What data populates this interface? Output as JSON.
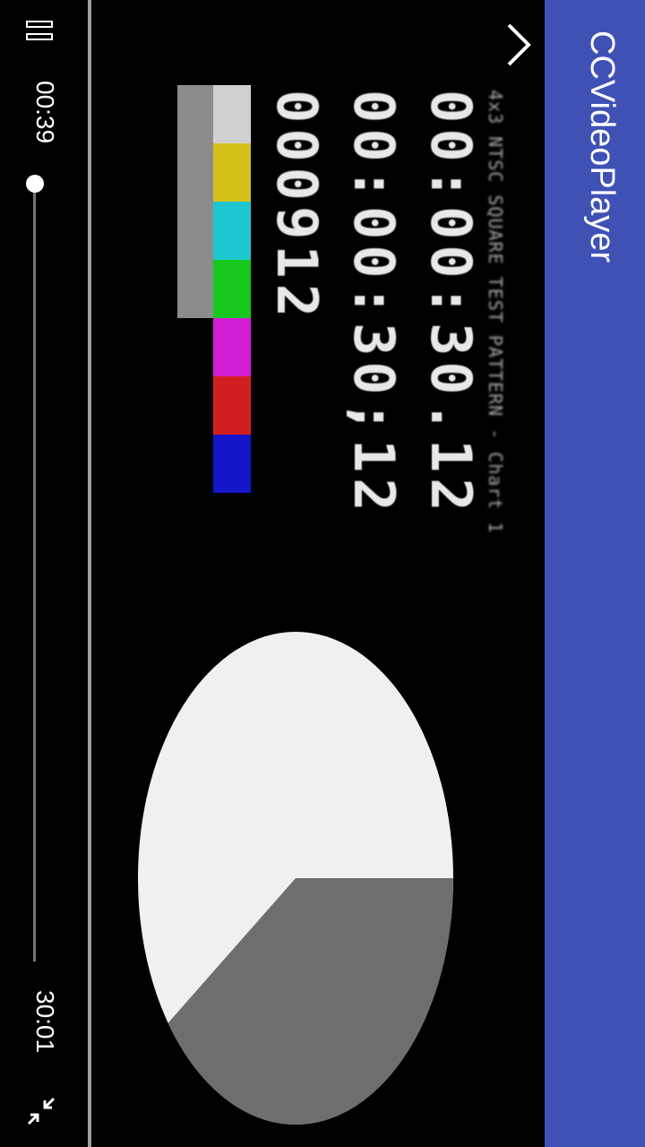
{
  "app": {
    "title": "CCVideoPlayer"
  },
  "video": {
    "caption": "4x3 NTSC SQUARE TEST PATTERN - Chart 1",
    "timecode_1": "00:00:30.12",
    "timecode_2": "00:00:30;12",
    "frame_count": "000912",
    "color_bars": [
      "#d0d0d0",
      "#d4c21a",
      "#1ec8d0",
      "#16c81e",
      "#d21ed2",
      "#d21e1e",
      "#1414c8"
    ],
    "gray_bars": [
      true,
      true,
      true,
      true,
      false,
      false,
      false
    ],
    "pie_progress_fraction": 0.6
  },
  "controls": {
    "current_time": "00:39",
    "total_time": "30:01",
    "progress_fraction": 0.0
  },
  "icons": {
    "back": "chevron-up-icon",
    "pause": "pause-icon",
    "fullscreen_exit": "fullscreen-exit-icon"
  },
  "colors": {
    "appbar": "#3f51b5",
    "seek_fill": "#4db6ac"
  }
}
